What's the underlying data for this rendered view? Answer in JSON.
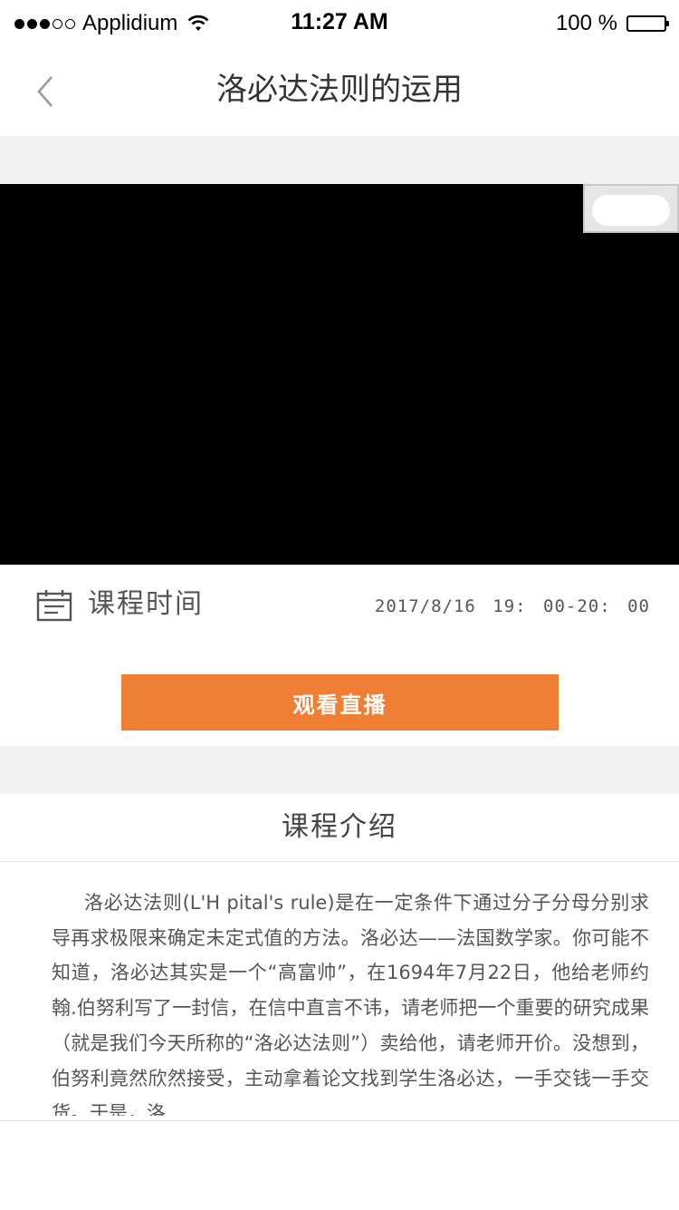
{
  "status_bar": {
    "carrier": "Applidium",
    "time": "11:27 AM",
    "battery_text": "100 %",
    "signal_bars_filled": 3,
    "signal_bars_total": 5
  },
  "nav": {
    "back_icon": "chevron-left-icon",
    "title": "洛必达法则的运用"
  },
  "course_time": {
    "icon": "calendar-icon",
    "label": "课程时间",
    "value": "2017/8/16 19: 00-20: 00"
  },
  "watch_button": {
    "label": "观看直播",
    "color": "#ee7f35"
  },
  "intro": {
    "title": "课程介绍",
    "body": "洛必达法则(L'H pital's rule)是在一定条件下通过分子分母分别求导再求极限来确定未定式值的方法。洛必达——法国数学家。你可能不知道，洛必达其实是一个“高富帅”，在1694年7月22日，他给老师约翰.伯努利写了一封信，在信中直言不讳，请老师把一个重要的研究成果（就是我们今天所称的“洛必达法则”）卖给他，请老师开价。没想到，伯努利竟然欣然接受，主动拿着论文找到学生洛必达，一手交钱一手交货。于是，洛"
  },
  "colors": {
    "accent": "#ee7f35",
    "separator": "#f2f2f2",
    "video_bg": "#000000"
  }
}
